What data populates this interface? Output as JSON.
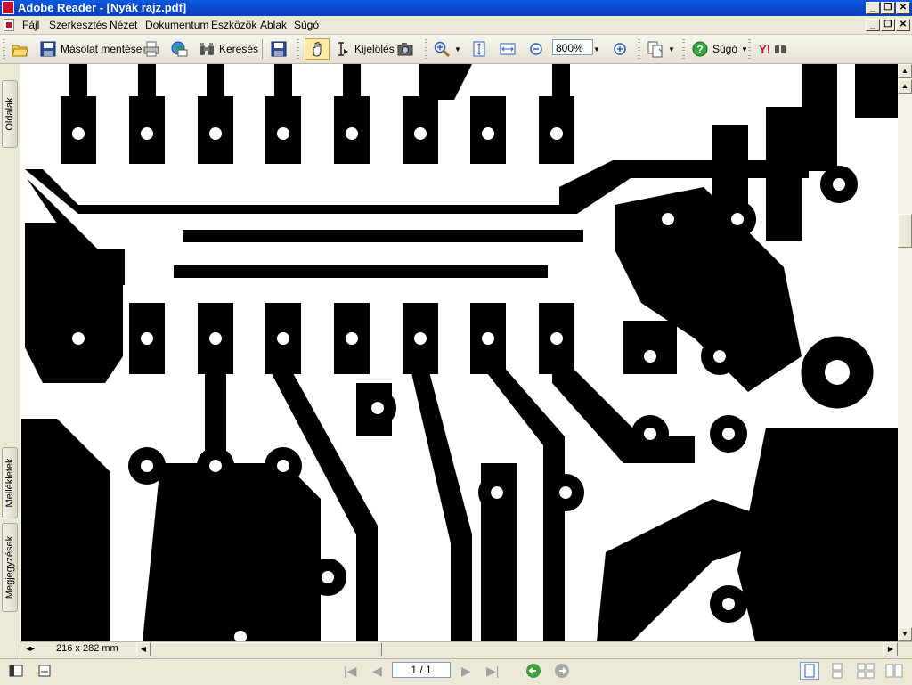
{
  "window": {
    "title": "Adobe Reader - [Nyák rajz.pdf]",
    "controls": [
      "_",
      "❐",
      "✕"
    ]
  },
  "menu": {
    "items": [
      "Fájl",
      "Szerkesztés",
      "Nézet",
      "Dokumentum",
      "Eszközök",
      "Ablak",
      "Súgó"
    ]
  },
  "toolbar": {
    "save_copy_label": "Másolat mentése",
    "search_label": "Keresés",
    "select_label": "Kijelölés",
    "zoom_value": "800%",
    "help_label": "Súgó"
  },
  "side_tabs": {
    "pages": "Oldalak",
    "attachments": "Mellékletek",
    "comments": "Megjegyzések"
  },
  "doc": {
    "page_size": "216 x 282 mm"
  },
  "status": {
    "page_indicator": "1 / 1"
  }
}
